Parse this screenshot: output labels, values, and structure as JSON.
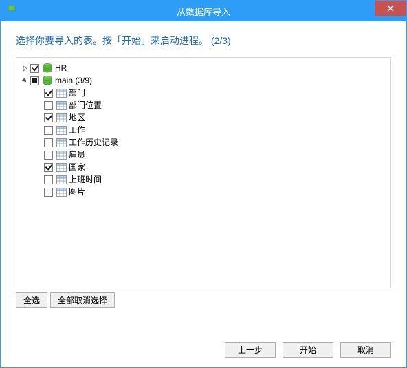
{
  "window": {
    "title": "从数据库导入"
  },
  "instruction": "选择你要导入的表。按「开始」来启动进程。 (2/3)",
  "tree": {
    "databases": [
      {
        "name": "HR",
        "expanded": false,
        "state": "checked",
        "children": []
      },
      {
        "name": "main (3/9)",
        "expanded": true,
        "state": "mixed",
        "children": [
          {
            "label": "部门",
            "checked": true
          },
          {
            "label": "部门位置",
            "checked": false
          },
          {
            "label": "地区",
            "checked": true
          },
          {
            "label": "工作",
            "checked": false
          },
          {
            "label": "工作历史记录",
            "checked": false
          },
          {
            "label": "雇员",
            "checked": false
          },
          {
            "label": "国家",
            "checked": true
          },
          {
            "label": "上班时间",
            "checked": false
          },
          {
            "label": "图片",
            "checked": false
          }
        ]
      }
    ]
  },
  "buttons": {
    "select_all": "全选",
    "deselect_all": "全部取消选择",
    "prev": "上一步",
    "start": "开始",
    "cancel": "取消"
  }
}
